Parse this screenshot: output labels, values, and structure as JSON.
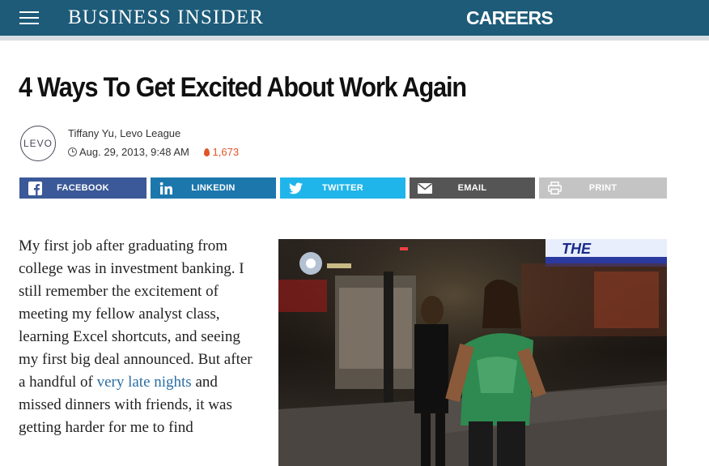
{
  "header": {
    "logo_text": "BUSINESS INSIDER",
    "section_label": "CAREERS",
    "bg_color": "#1d5b79",
    "menu_icon": "hamburger-menu-icon"
  },
  "article": {
    "title": "4 Ways To Get Excited About Work Again",
    "author_logo_text": "LEVO",
    "author": "Tiffany Yu, Levo League",
    "date": "Aug. 29, 2013, 9:48 AM",
    "views": "1,673"
  },
  "share": {
    "facebook": "FACEBOOK",
    "linkedin": "LINKEDIN",
    "twitter": "TWITTER",
    "email": "EMAIL",
    "print": "PRINT",
    "colors": {
      "facebook": "#3b5998",
      "linkedin": "#1c77ad",
      "twitter": "#20b5ea",
      "email": "#555555",
      "print": "#c4c4c4"
    }
  },
  "body": {
    "para1_before": "My first job after graduating from college was in investment banking. I still remember the excitement of meeting my fellow analyst class, learning Excel shortcuts, and seeing my first big deal announced. But after a handful of ",
    "para1_link": "very late nights",
    "para1_after": " and missed dinners with friends, it was getting harder for me to find"
  },
  "photo": {
    "sign_text": "THE"
  }
}
